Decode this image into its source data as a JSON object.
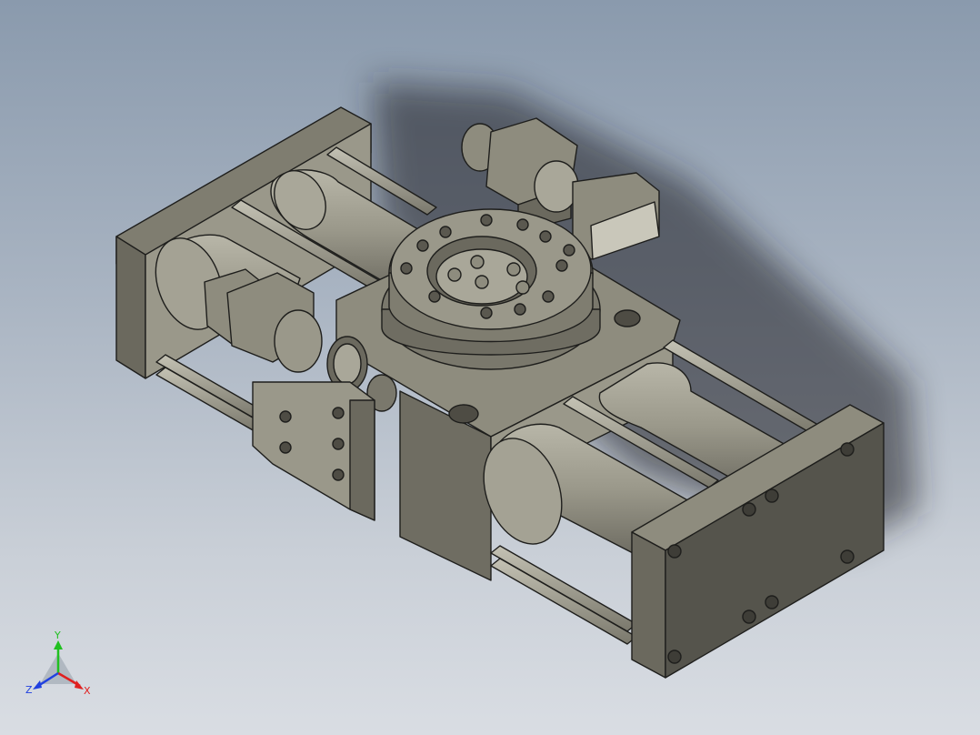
{
  "viewport": {
    "background_top": "#8a9aad",
    "background_bottom": "#d9dde3",
    "model_color": "#8e8c7e",
    "edge_color": "#1e1e1c"
  },
  "triad": {
    "x_label": "X",
    "y_label": "Y",
    "z_label": "Z",
    "x_color": "#e02020",
    "y_color": "#20c020",
    "z_color": "#2040e0"
  }
}
